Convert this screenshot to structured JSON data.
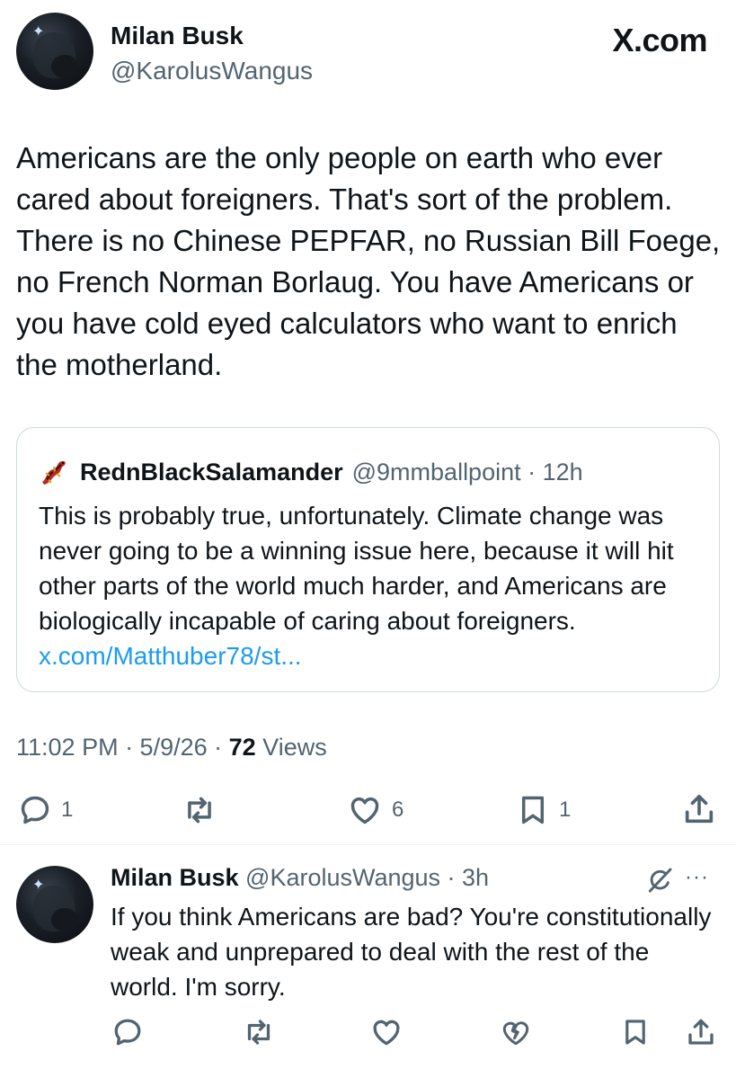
{
  "tweet": {
    "author_name": "Milan Busk",
    "author_handle": "@KarolusWangus",
    "brand": "X",
    "brand_suffix": ".com",
    "body": "Americans are the only people on earth who ever cared about foreigners. That's sort of the problem. There is no Chinese PEPFAR, no Russian Bill Foege, no French Norman Borlaug. You have Americans or you have cold eyed calculators who want to enrich the motherland.",
    "quote": {
      "author_name": "RednBlackSalamander",
      "meta": "@9mmballpoint · 12h",
      "text": "This is probably true, unfortunately. Climate change was never going to be a winning issue here, because it will hit other parts of the world much harder, and Americans are biologically incapable of caring about foreigners. ",
      "link": "x.com/Matthuber78/st..."
    },
    "meta": {
      "time_date": "11:02 PM · 5/9/26 · ",
      "views_count": "72",
      "views_label": " Views"
    },
    "actions": {
      "replies": "1",
      "likes": "6",
      "bookmarks": "1"
    }
  },
  "reply": {
    "author_name": "Milan Busk",
    "meta": " @KarolusWangus · 3h",
    "text": "If you think Americans are bad? You're constitutionally weak and unprepared to deal with the rest of the world. I'm sorry.",
    "more": "···"
  },
  "icons": {
    "reply": "speech-bubble-icon",
    "retweet": "retweet-icon",
    "like": "heart-icon",
    "bookmark": "bookmark-icon",
    "share": "share-icon",
    "grok": "grok-icon",
    "dislike": "broken-heart-icon"
  },
  "colors": {
    "text": "#0f1419",
    "secondary": "#536471",
    "link": "#1d9bf0",
    "border": "#cfd9de"
  }
}
